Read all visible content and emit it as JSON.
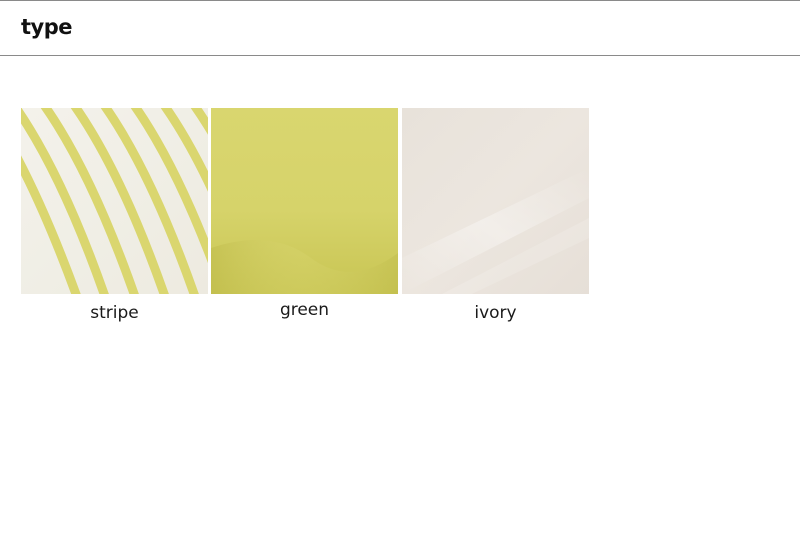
{
  "header": {
    "title": "type"
  },
  "swatches": [
    {
      "label": "stripe",
      "icon": "stripe-fabric-swatch",
      "base_color": "#f1efe7",
      "accent_color": "#d9d667"
    },
    {
      "label": "green",
      "icon": "green-fabric-swatch",
      "base_color": "#d6d46b",
      "accent_color": "#c2bf4e"
    },
    {
      "label": "ivory",
      "icon": "ivory-fabric-swatch",
      "base_color": "#ebe5de",
      "accent_color": "#f3efe9"
    }
  ]
}
